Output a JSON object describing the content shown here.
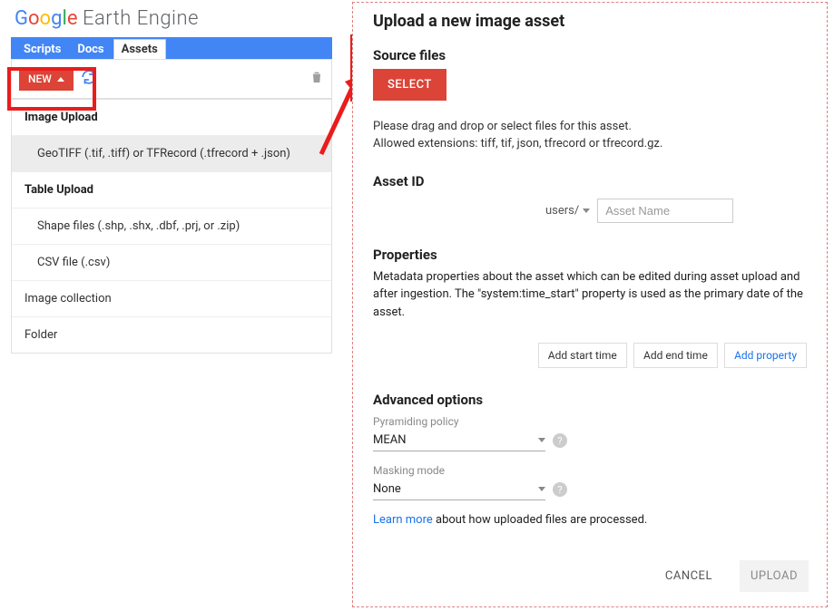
{
  "logo": {
    "earth_engine": "Earth Engine"
  },
  "tabs": {
    "scripts": "Scripts",
    "docs": "Docs",
    "assets": "Assets"
  },
  "toolbar": {
    "new_label": "NEW"
  },
  "menu": {
    "image_upload_header": "Image Upload",
    "geotiff_item": "GeoTIFF (.tif, .tiff) or TFRecord (.tfrecord + .json)",
    "table_upload_header": "Table Upload",
    "shape_item": "Shape files (.shp, .shx, .dbf, .prj, or .zip)",
    "csv_item": "CSV file (.csv)",
    "image_collection": "Image collection",
    "folder": "Folder"
  },
  "dialog": {
    "title": "Upload a new image asset",
    "source_files_label": "Source files",
    "select_label": "SELECT",
    "drag_text": "Please drag and drop or select files for this asset.",
    "allowed_text": "Allowed extensions: tiff, tif, json, tfrecord or tfrecord.gz.",
    "asset_id_label": "Asset ID",
    "users_prefix": "users/",
    "asset_name_placeholder": "Asset Name",
    "properties_label": "Properties",
    "properties_text": "Metadata properties about the asset which can be edited during asset upload and after ingestion. The \"system:time_start\" property is used as the primary date of the asset.",
    "add_start": "Add start time",
    "add_end": "Add end time",
    "add_prop": "Add property",
    "advanced_label": "Advanced options",
    "pyramiding_label": "Pyramiding policy",
    "pyramiding_value": "MEAN",
    "masking_label": "Masking mode",
    "masking_value": "None",
    "learn_more": "Learn more",
    "learn_rest": " about how uploaded files are processed.",
    "cancel": "CANCEL",
    "upload": "UPLOAD"
  }
}
